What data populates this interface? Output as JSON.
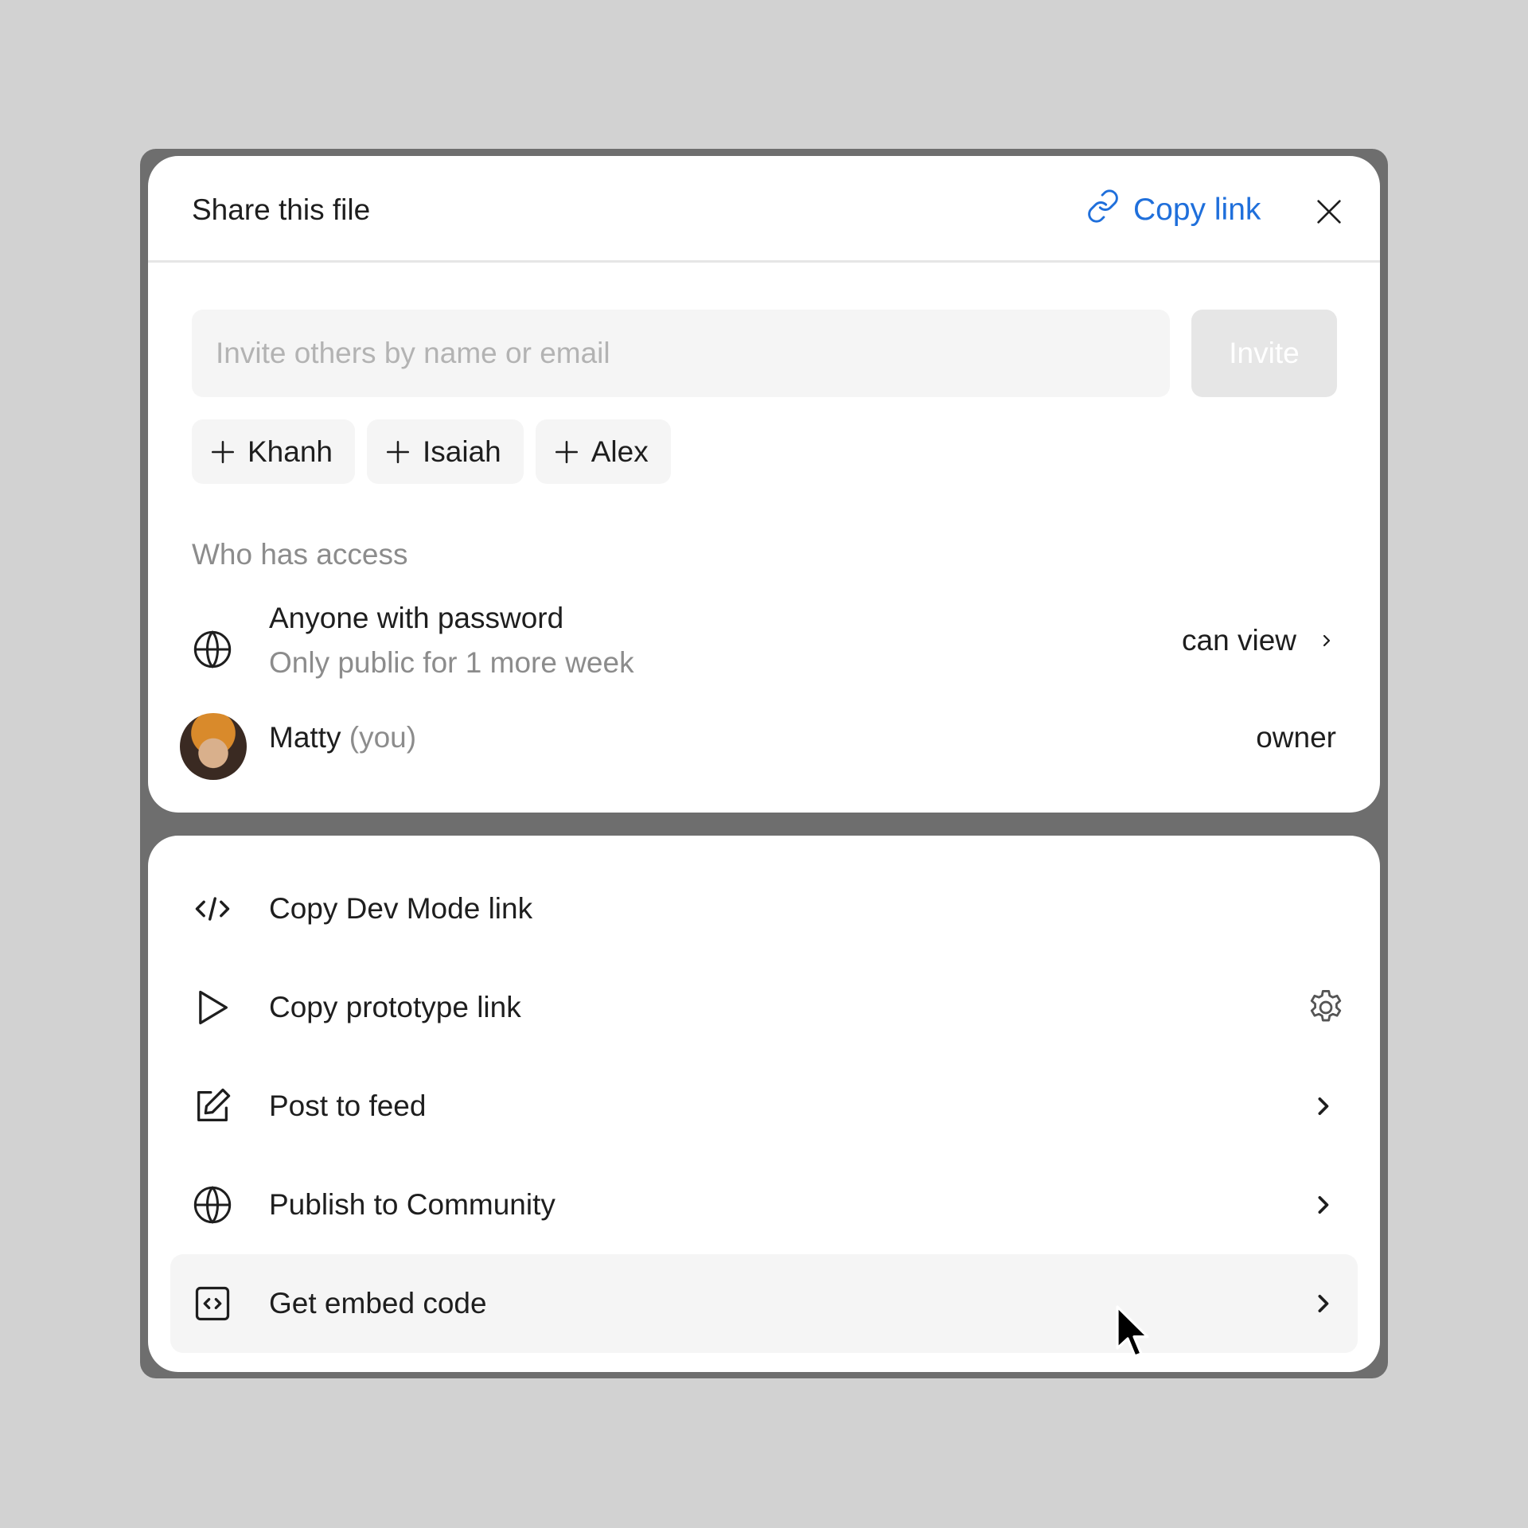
{
  "dialog": {
    "title": "Share this file",
    "copy_link_label": "Copy link",
    "accent_color": "#1f6fdb"
  },
  "invite": {
    "placeholder": "Invite others by name or email",
    "button_label": "Invite",
    "suggestions": [
      "Khanh",
      "Isaiah",
      "Alex"
    ]
  },
  "access": {
    "section_label": "Who has access",
    "entries": [
      {
        "icon": "globe-icon",
        "title": "Anyone with password",
        "subtitle": "Only public for 1 more week",
        "permission": "can view"
      },
      {
        "icon": "avatar",
        "name": "Matty",
        "suffix": "(you)",
        "permission": "owner"
      }
    ]
  },
  "menu": {
    "items": [
      {
        "icon": "code-icon",
        "label": "Copy Dev Mode link"
      },
      {
        "icon": "play-icon",
        "label": "Copy prototype link",
        "right_icon": "gear-icon"
      },
      {
        "icon": "edit-icon",
        "label": "Post to feed",
        "right_icon": "chevron-right-icon"
      },
      {
        "icon": "globe-icon",
        "label": "Publish to Community",
        "right_icon": "chevron-right-icon"
      },
      {
        "icon": "embed-icon",
        "label": "Get embed code",
        "right_icon": "chevron-right-icon",
        "hovered": true
      }
    ]
  }
}
